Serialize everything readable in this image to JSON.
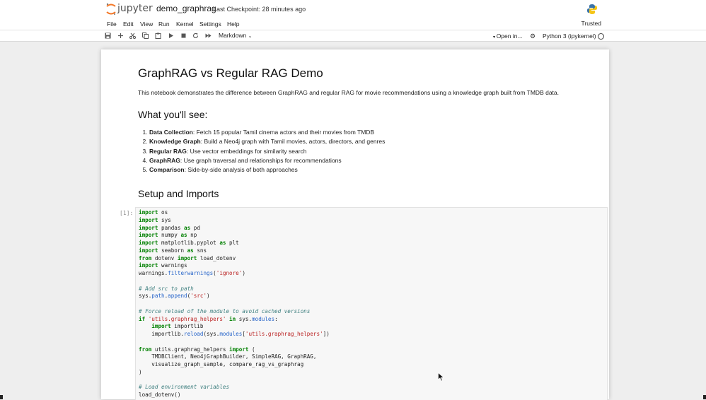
{
  "header": {
    "logo_text": "jupyter",
    "notebook_name": "demo_graphrag",
    "checkpoint": "Last Checkpoint: 28 minutes ago",
    "trusted": "Trusted"
  },
  "menu": [
    "File",
    "Edit",
    "View",
    "Run",
    "Kernel",
    "Settings",
    "Help"
  ],
  "toolbar": {
    "icons": [
      "save-icon",
      "add-icon",
      "cut-icon",
      "copy-icon",
      "paste-icon",
      "run-icon",
      "stop-icon",
      "restart-icon",
      "fast-forward-icon"
    ],
    "cell_type": "Markdown",
    "open_in": "Open in...",
    "kernel": "Python 3 (ipykernel)"
  },
  "notebook": {
    "title": "GraphRAG vs Regular RAG Demo",
    "intro": "This notebook demonstrates the difference between GraphRAG and regular RAG for movie recommendations using a knowledge graph built from TMDB data.",
    "section1": "What you'll see:",
    "features": [
      {
        "bold": "Data Collection",
        "text": ": Fetch 15 popular Tamil cinema actors and their movies from TMDB"
      },
      {
        "bold": "Knowledge Graph",
        "text": ": Build a Neo4j graph with Tamil movies, actors, directors, and genres"
      },
      {
        "bold": "Regular RAG",
        "text": ": Use vector embeddings for similarity search"
      },
      {
        "bold": "GraphRAG",
        "text": ": Use graph traversal and relationships for recommendations"
      },
      {
        "bold": "Comparison",
        "text": ": Side-by-side analysis of both approaches"
      }
    ],
    "section2": "Setup and Imports",
    "cell_prompt": "[1]:",
    "code_lines": [
      [
        [
          "kw",
          "import"
        ],
        [
          "t",
          " os"
        ]
      ],
      [
        [
          "kw",
          "import"
        ],
        [
          "t",
          " sys"
        ]
      ],
      [
        [
          "kw",
          "import"
        ],
        [
          "t",
          " pandas "
        ],
        [
          "kw",
          "as"
        ],
        [
          "t",
          " pd"
        ]
      ],
      [
        [
          "kw",
          "import"
        ],
        [
          "t",
          " numpy "
        ],
        [
          "kw",
          "as"
        ],
        [
          "t",
          " np"
        ]
      ],
      [
        [
          "kw",
          "import"
        ],
        [
          "t",
          " matplotlib.pyplot "
        ],
        [
          "kw",
          "as"
        ],
        [
          "t",
          " plt"
        ]
      ],
      [
        [
          "kw",
          "import"
        ],
        [
          "t",
          " seaborn "
        ],
        [
          "kw",
          "as"
        ],
        [
          "t",
          " sns"
        ]
      ],
      [
        [
          "kw",
          "from"
        ],
        [
          "t",
          " dotenv "
        ],
        [
          "kw",
          "import"
        ],
        [
          "t",
          " load_dotenv"
        ]
      ],
      [
        [
          "kw",
          "import"
        ],
        [
          "t",
          " warnings"
        ]
      ],
      [
        [
          "t",
          "warnings."
        ],
        [
          "fn",
          "filterwarnings"
        ],
        [
          "t",
          "("
        ],
        [
          "st",
          "'ignore'"
        ],
        [
          "t",
          ")"
        ]
      ],
      [],
      [
        [
          "cm",
          "# Add src to path"
        ]
      ],
      [
        [
          "t",
          "sys."
        ],
        [
          "fn",
          "path"
        ],
        [
          "t",
          "."
        ],
        [
          "fn",
          "append"
        ],
        [
          "t",
          "("
        ],
        [
          "st",
          "'src'"
        ],
        [
          "t",
          ")"
        ]
      ],
      [],
      [
        [
          "cm",
          "# Force reload of the module to avoid cached versions"
        ]
      ],
      [
        [
          "kw",
          "if"
        ],
        [
          "t",
          " "
        ],
        [
          "st",
          "'utils.graphrag_helpers'"
        ],
        [
          "t",
          " "
        ],
        [
          "kw",
          "in"
        ],
        [
          "t",
          " sys."
        ],
        [
          "fn",
          "modules"
        ],
        [
          "t",
          ":"
        ]
      ],
      [
        [
          "t",
          "    "
        ],
        [
          "kw",
          "import"
        ],
        [
          "t",
          " importlib"
        ]
      ],
      [
        [
          "t",
          "    importlib."
        ],
        [
          "fn",
          "reload"
        ],
        [
          "t",
          "(sys."
        ],
        [
          "fn",
          "modules"
        ],
        [
          "t",
          "["
        ],
        [
          "st",
          "'utils.graphrag_helpers'"
        ],
        [
          "t",
          "])"
        ]
      ],
      [],
      [
        [
          "kw",
          "from"
        ],
        [
          "t",
          " utils.graphrag_helpers "
        ],
        [
          "kw",
          "import"
        ],
        [
          "t",
          " ("
        ]
      ],
      [
        [
          "t",
          "    TMDBClient, Neo4jGraphBuilder, SimpleRAG, GraphRAG,"
        ]
      ],
      [
        [
          "t",
          "    visualize_graph_sample, compare_rag_vs_graphrag"
        ]
      ],
      [
        [
          "t",
          ")"
        ]
      ],
      [],
      [
        [
          "cm",
          "# Load environment variables"
        ]
      ],
      [
        [
          "t",
          "load_dotenv()"
        ]
      ]
    ]
  }
}
